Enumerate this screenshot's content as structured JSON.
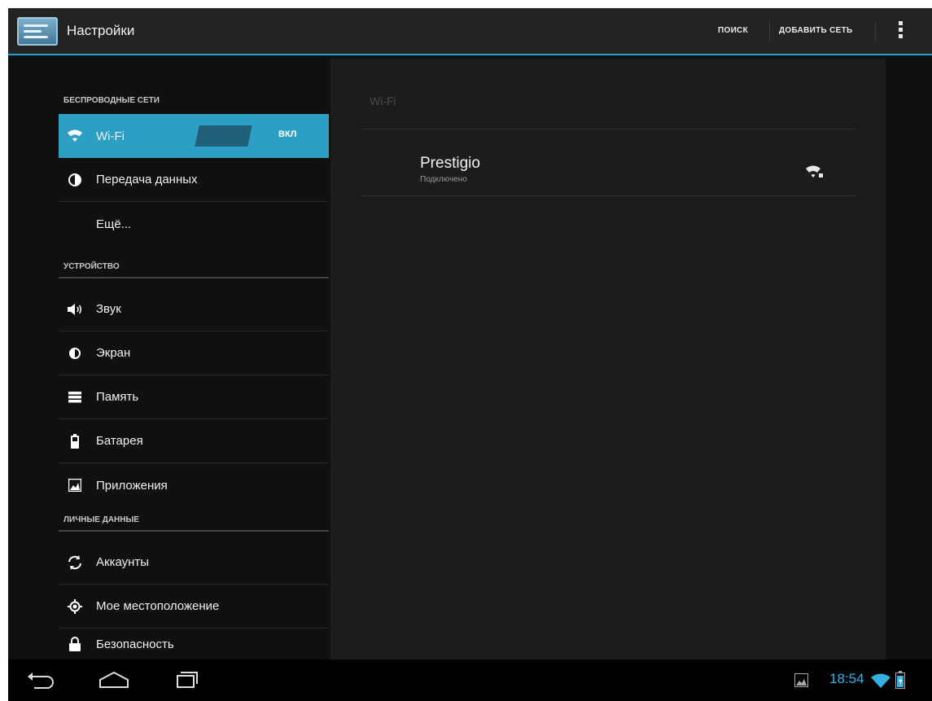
{
  "action_bar": {
    "title": "Настройки",
    "actions": [
      "ПОИСК",
      "ДОБАВИТЬ СЕТЬ"
    ],
    "accent_color": "#2e9fc4"
  },
  "sidebar": {
    "sections": [
      {
        "header": "БЕСПРОВОДНЫЕ СЕТИ",
        "items": [
          {
            "label": "Wi-Fi",
            "icon": "wifi-icon",
            "selected": true,
            "toggle": "ВКЛ"
          },
          {
            "label": "Передача данных",
            "icon": "data-usage-icon"
          },
          {
            "label": "Ещё...",
            "icon": ""
          }
        ]
      },
      {
        "header": "УСТРОЙСТВО",
        "items": [
          {
            "label": "Звук",
            "icon": "sound-icon"
          },
          {
            "label": "Экран",
            "icon": "display-icon"
          },
          {
            "label": "Память",
            "icon": "storage-icon"
          },
          {
            "label": "Батарея",
            "icon": "battery-icon"
          },
          {
            "label": "Приложения",
            "icon": "apps-icon"
          }
        ]
      },
      {
        "header": "ЛИЧНЫЕ ДАННЫЕ",
        "items": [
          {
            "label": "Аккаунты",
            "icon": "sync-icon"
          },
          {
            "label": "Мое местоположение",
            "icon": "location-icon"
          },
          {
            "label": "Безопасность",
            "icon": "lock-icon"
          }
        ]
      }
    ]
  },
  "content": {
    "title": "Wi-Fi",
    "networks": [
      {
        "name": "Prestigio",
        "status": "Подключено",
        "icon": "wifi-signal-icon"
      }
    ]
  },
  "status_bar": {
    "time": "18:54"
  }
}
